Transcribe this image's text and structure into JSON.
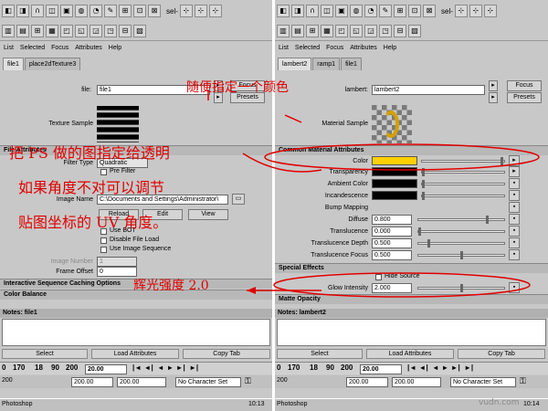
{
  "left": {
    "menu": [
      "List",
      "Selected",
      "Focus",
      "Attributes",
      "Help"
    ],
    "tabs": [
      "file1",
      "place2dTexture3"
    ],
    "node_label": "file:",
    "node_value": "file1",
    "focus": "Focus",
    "presets": "Presets",
    "texture_sample": "Texture Sample",
    "section_file": "File Attributes",
    "filter_type_label": "Filter Type",
    "filter_type_value": "Quadratic",
    "pre_filter": "Pre Filter",
    "image_name_label": "Image Name",
    "image_name_value": "C:\\Documents and Settings\\Administrator\\",
    "reload": "Reload",
    "edit": "Edit",
    "view": "View",
    "use_bot": "Use BOT",
    "disable_file_load": "Disable File Load",
    "use_image_sequence": "Use Image Sequence",
    "image_number": "Image Number",
    "image_number_value": "1",
    "frame_offset": "Frame Offset",
    "frame_offset_value": "0",
    "section_isc": "Interactive Sequence Caching Options",
    "section_color_balance": "Color Balance",
    "notes": "Notes: file1",
    "select": "Select",
    "load_attributes": "Load Attributes",
    "copy_tab": "Copy Tab",
    "time_ticks": [
      "0",
      "170",
      "18",
      "90",
      "200"
    ],
    "current_time": "20.00",
    "range_left": "200",
    "range_a": "200.00",
    "range_b": "200.00",
    "no_char_set": "No Character Set",
    "clock": "10:13",
    "taskbar_app": "Photoshop",
    "menu_sel": "sel-"
  },
  "right": {
    "menu": [
      "List",
      "Selected",
      "Focus",
      "Attributes",
      "Help"
    ],
    "tabs": [
      "lambert2",
      "ramp1",
      "file1"
    ],
    "node_label": "lambert:",
    "node_value": "lambert2",
    "focus": "Focus",
    "presets": "Presets",
    "material_sample": "Material Sample",
    "section_common": "Common Material Attributes",
    "color": "Color",
    "transparency": "Transparency",
    "ambient_color": "Ambient Color",
    "incandescence": "Incandescence",
    "bump_mapping": "Bump Mapping",
    "diffuse": "Diffuse",
    "diffuse_value": "0.800",
    "translucence": "Translucence",
    "translucence_value": "0.000",
    "translucence_depth": "Translucence Depth",
    "translucence_depth_value": "0.500",
    "translucence_focus": "Translucence Focus",
    "translucence_focus_value": "0.500",
    "section_special": "Special Effects",
    "hide_source": "Hide Source",
    "glow_intensity": "Glow Intensity",
    "glow_intensity_value": "2.000",
    "section_matte": "Matte Opacity",
    "notes": "Notes: lambert2",
    "select": "Select",
    "load_attributes": "Load Attributes",
    "copy_tab": "Copy Tab",
    "time_ticks": [
      "0",
      "170",
      "18",
      "90",
      "200"
    ],
    "current_time": "20.00",
    "range_left": "200",
    "range_a": "200.00",
    "range_b": "200.00",
    "no_char_set": "No Character Set",
    "clock": "10:14",
    "taskbar_app": "Photoshop",
    "menu_sel": "sel-"
  },
  "annotations": {
    "a1": "随便指定一个颜色",
    "a2": "把 PS 做的图指定给透明",
    "a3": "如果角度不对可以调节",
    "a4": "贴图坐标的 UV 角度。",
    "a5": "辉光强度 2.0"
  },
  "watermark": "vudn.com",
  "colors": {
    "annotation": "#e00000",
    "color_swatch": "#ffd000"
  }
}
